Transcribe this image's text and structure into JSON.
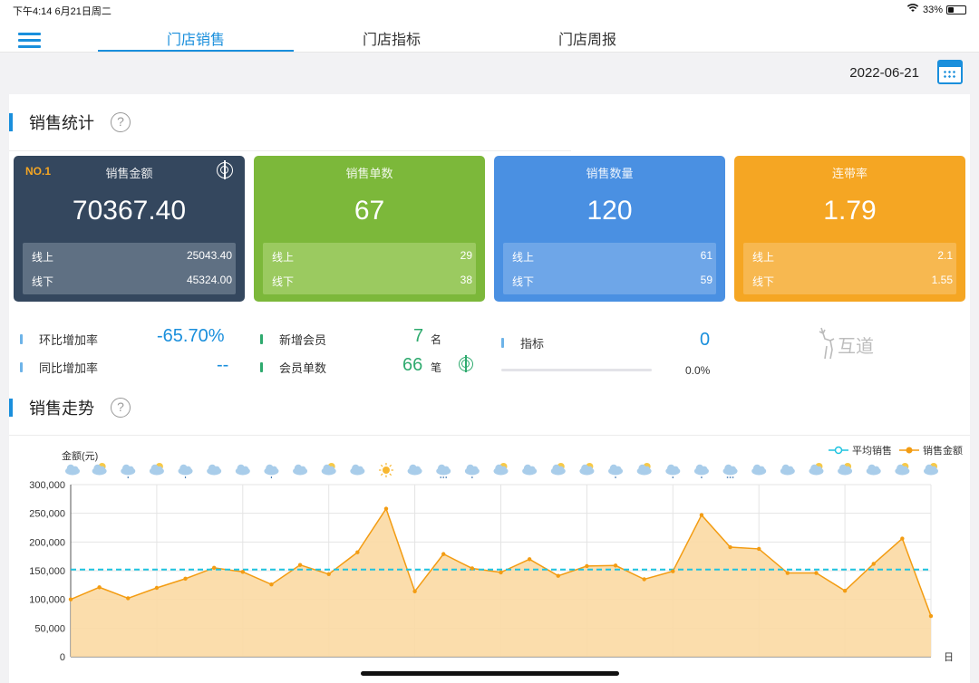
{
  "status": {
    "time": "下午4:14  6月21日周二",
    "battery": "33%",
    "battery_level": 0.33
  },
  "tabs": [
    {
      "label": "门店销售",
      "active": true
    },
    {
      "label": "门店指标",
      "active": false
    },
    {
      "label": "门店周报",
      "active": false
    }
  ],
  "date": "2022-06-21",
  "sales_stats": {
    "title": "销售统计",
    "help": "?",
    "cards": [
      {
        "rank": "NO.1",
        "title": "销售金额",
        "value": "70367.40",
        "online_label": "线上",
        "online": "25043.40",
        "offline_label": "线下",
        "offline": "45324.00",
        "color": "#34475e",
        "sub_color": "#5f7083"
      },
      {
        "title": "销售单数",
        "value": "67",
        "online_label": "线上",
        "online": "29",
        "offline_label": "线下",
        "offline": "38",
        "color": "#7cb83a",
        "sub_color": "#9bca60"
      },
      {
        "title": "销售数量",
        "value": "120",
        "online_label": "线上",
        "online": "61",
        "offline_label": "线下",
        "offline": "59",
        "color": "#4a90e2",
        "sub_color": "#6ea6e8"
      },
      {
        "title": "连带率",
        "value": "1.79",
        "online_label": "线上",
        "online": "2.1",
        "offline_label": "线下",
        "offline": "1.55",
        "color": "#f5a623",
        "sub_color": "#f7b850"
      }
    ],
    "metrics": {
      "mom_label": "环比增加率",
      "mom_value": "-65.70%",
      "yoy_label": "同比增加率",
      "yoy_value": "--",
      "new_members_label": "新增会员",
      "new_members_value": "7",
      "new_members_unit": "名",
      "member_orders_label": "会员单数",
      "member_orders_value": "66",
      "member_orders_unit": "笔",
      "target_label": "指标",
      "target_value": "0",
      "target_percent": "0.0%",
      "target_progress": 0
    },
    "logo_text": "互道"
  },
  "trend": {
    "title": "销售走势",
    "help": "?"
  },
  "chart_data": {
    "type": "area",
    "ylabel": "金额(元)",
    "xlabel": "日",
    "ylim": [
      0,
      300000
    ],
    "yticks": [
      "0",
      "50,000",
      "100,000",
      "150,000",
      "200,000",
      "250,000",
      "300,000"
    ],
    "legend": [
      "平均销售",
      "销售金额"
    ],
    "legend_position": "top-right",
    "grid": true,
    "series": [
      {
        "name": "销售金额",
        "color": "#f39c12",
        "values": [
          100000,
          121000,
          102000,
          120000,
          136000,
          155000,
          148000,
          126000,
          160000,
          144000,
          182000,
          258000,
          114000,
          179000,
          154000,
          147000,
          170000,
          141000,
          158000,
          159000,
          135000,
          149000,
          247000,
          191000,
          188000,
          146000,
          146000,
          115000,
          162000,
          206000,
          71000
        ]
      },
      {
        "name": "平均销售",
        "color": "#1fc3e0",
        "values": [
          152000
        ]
      }
    ],
    "weather": [
      "cloud",
      "suncloud",
      "rain",
      "suncloud",
      "rain",
      "cloud",
      "cloud",
      "rain",
      "cloud",
      "suncloud",
      "cloud",
      "sun",
      "cloud",
      "snow",
      "rain",
      "suncloud",
      "cloud",
      "suncloud",
      "suncloud",
      "rain",
      "suncloud",
      "rain",
      "rain",
      "snow",
      "cloud",
      "cloud",
      "suncloud",
      "suncloud",
      "cloud",
      "suncloud",
      "suncloud"
    ],
    "colors": {
      "fill": "#fbd9a3",
      "line": "#f39c12",
      "avg": "#1fc3e0"
    }
  }
}
